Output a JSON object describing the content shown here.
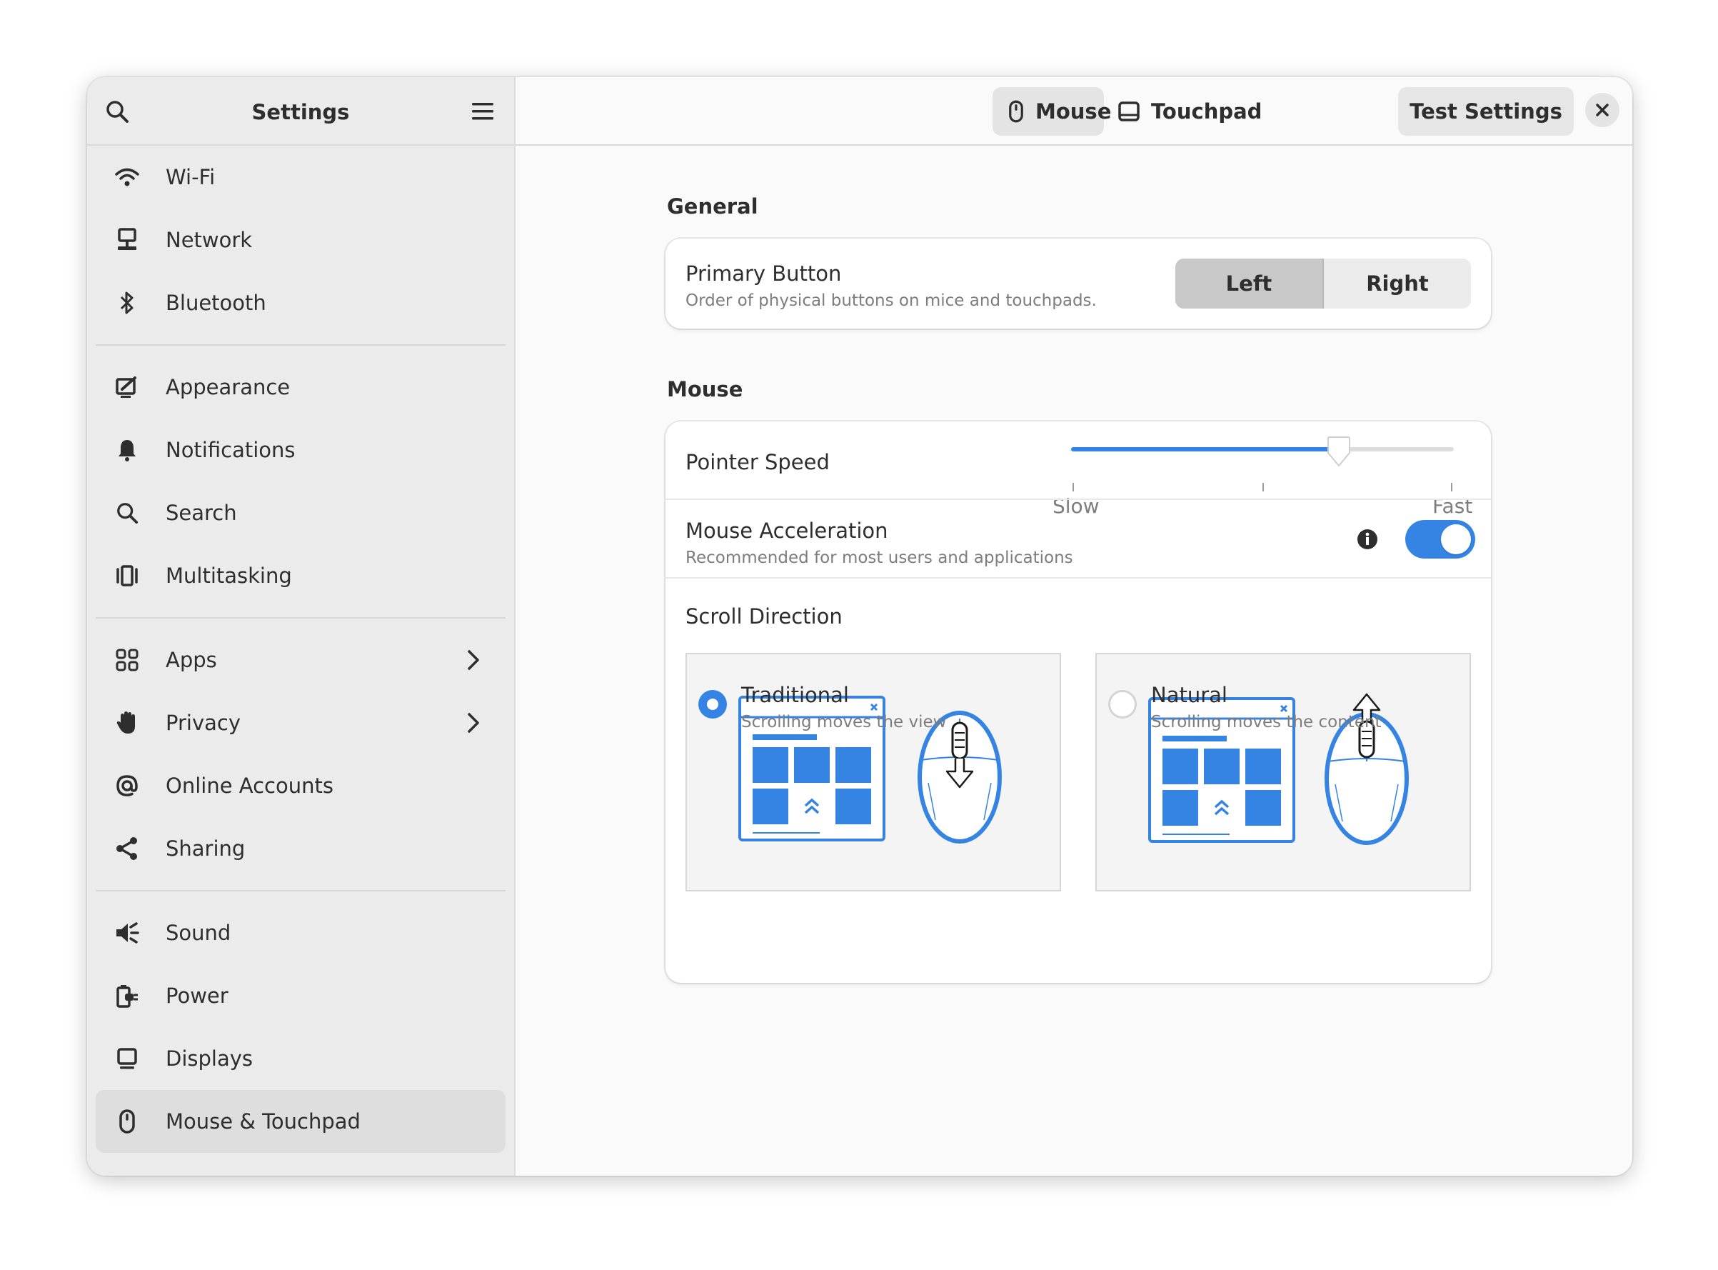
{
  "sidebar": {
    "title": "Settings",
    "search_icon": "search-icon",
    "menu_icon": "hamburger-menu-icon",
    "groups": [
      [
        {
          "label": "Wi-Fi",
          "icon": "wifi-icon"
        },
        {
          "label": "Network",
          "icon": "network-icon"
        },
        {
          "label": "Bluetooth",
          "icon": "bluetooth-icon"
        }
      ],
      [
        {
          "label": "Appearance",
          "icon": "appearance-icon"
        },
        {
          "label": "Notifications",
          "icon": "bell-icon"
        },
        {
          "label": "Search",
          "icon": "search-icon"
        },
        {
          "label": "Multitasking",
          "icon": "multitasking-icon"
        }
      ],
      [
        {
          "label": "Apps",
          "icon": "apps-grid-icon",
          "has_arrow": true
        },
        {
          "label": "Privacy",
          "icon": "hand-icon",
          "has_arrow": true
        },
        {
          "label": "Online Accounts",
          "icon": "at-sign-icon"
        },
        {
          "label": "Sharing",
          "icon": "share-icon"
        }
      ],
      [
        {
          "label": "Sound",
          "icon": "speaker-icon"
        },
        {
          "label": "Power",
          "icon": "power-plug-icon"
        },
        {
          "label": "Displays",
          "icon": "display-icon"
        },
        {
          "label": "Mouse & Touchpad",
          "icon": "mouse-icon",
          "active": true
        }
      ]
    ]
  },
  "header": {
    "tabs": [
      {
        "label": "Mouse",
        "icon": "mouse-icon",
        "active": true
      },
      {
        "label": "Touchpad",
        "icon": "touchpad-icon",
        "active": false
      }
    ],
    "test_button": "Test Settings",
    "close_icon": "close-icon"
  },
  "general": {
    "section_title": "General",
    "primary_button": {
      "title": "Primary Button",
      "subtitle": "Order of physical buttons on mice and touchpads.",
      "options": [
        "Left",
        "Right"
      ],
      "selected": "Left"
    }
  },
  "mouse": {
    "section_title": "Mouse",
    "pointer_speed": {
      "title": "Pointer Speed",
      "min_label": "Slow",
      "max_label": "Fast",
      "value_fraction": 0.7
    },
    "acceleration": {
      "title": "Mouse Acceleration",
      "subtitle": "Recommended for most users and applications",
      "enabled": true
    },
    "scroll_direction": {
      "title": "Scroll Direction",
      "options": [
        {
          "title": "Traditional",
          "subtitle": "Scrolling moves the view",
          "selected": true
        },
        {
          "title": "Natural",
          "subtitle": "Scrolling moves the content",
          "selected": false
        }
      ]
    }
  },
  "colors": {
    "accent": "#3584e4",
    "sidebar_bg": "#ebebeb",
    "content_bg": "#fafafa"
  }
}
